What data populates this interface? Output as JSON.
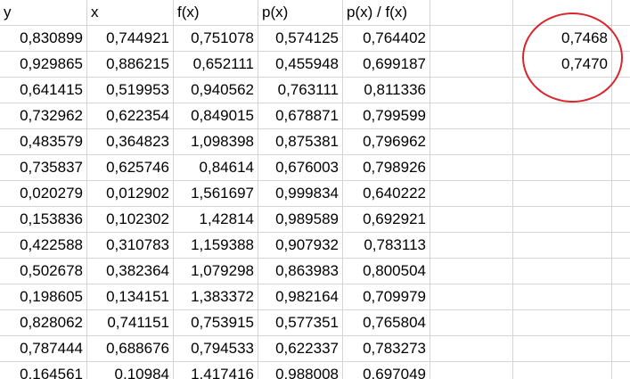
{
  "sheet": {
    "headers": [
      "y",
      "x",
      "f(x)",
      "p(x)",
      "p(x) / f(x)"
    ],
    "rows": [
      [
        "0,830899",
        "0,744921",
        "0,751078",
        "0,574125",
        "0,764402"
      ],
      [
        "0,929865",
        "0,886215",
        "0,652111",
        "0,455948",
        "0,699187"
      ],
      [
        "0,641415",
        "0,519953",
        "0,940562",
        "0,763111",
        "0,811336"
      ],
      [
        "0,732962",
        "0,622354",
        "0,849015",
        "0,678871",
        "0,799599"
      ],
      [
        "0,483579",
        "0,364823",
        "1,098398",
        "0,875381",
        "0,796962"
      ],
      [
        "0,735837",
        "0,625746",
        "0,84614",
        "0,676003",
        "0,798926"
      ],
      [
        "0,020279",
        "0,012902",
        "1,561697",
        "0,999834",
        "0,640222"
      ],
      [
        "0,153836",
        "0,102302",
        "1,42814",
        "0,989589",
        "0,692921"
      ],
      [
        "0,422588",
        "0,310783",
        "1,159388",
        "0,907932",
        "0,783113"
      ],
      [
        "0,502678",
        "0,382364",
        "1,079298",
        "0,863983",
        "0,800504"
      ],
      [
        "0,198605",
        "0,134151",
        "1,383372",
        "0,982164",
        "0,709979"
      ],
      [
        "0,828062",
        "0,741151",
        "0,753915",
        "0,577351",
        "0,765804"
      ],
      [
        "0,787444",
        "0,688676",
        "0,794533",
        "0,622337",
        "0,783273"
      ],
      [
        "0,164561",
        "0,10984",
        "1,417416",
        "0,988008",
        "0,697049"
      ]
    ],
    "side_values": [
      "0,7468",
      "0,7470"
    ],
    "marker_color": "#d9262c"
  }
}
